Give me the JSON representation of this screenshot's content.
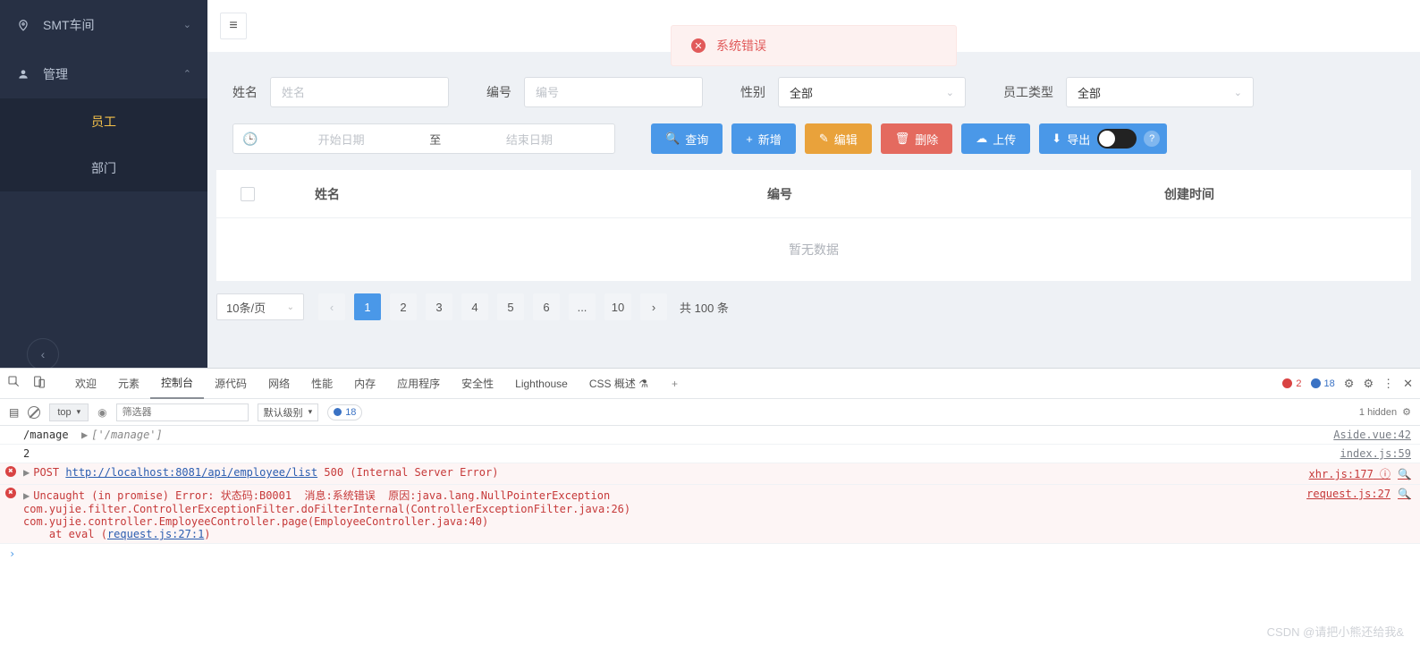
{
  "sidebar": {
    "group1": {
      "label": "SMT车间",
      "expanded": false
    },
    "group2": {
      "label": "管理",
      "expanded": true
    },
    "items": [
      {
        "label": "员工",
        "active": true
      },
      {
        "label": "部门",
        "active": false
      }
    ]
  },
  "error_banner": {
    "text": "系统错误"
  },
  "filters": {
    "name": {
      "label": "姓名",
      "placeholder": "姓名"
    },
    "code": {
      "label": "编号",
      "placeholder": "编号"
    },
    "gender": {
      "label": "性别",
      "value": "全部"
    },
    "emp_type": {
      "label": "员工类型",
      "value": "全部"
    },
    "date_range": {
      "start_ph": "开始日期",
      "sep": "至",
      "end_ph": "结束日期"
    }
  },
  "buttons": {
    "query": "查询",
    "add": "新增",
    "edit": "编辑",
    "delete": "删除",
    "upload": "上传",
    "export": "导出"
  },
  "table": {
    "columns": [
      "姓名",
      "编号",
      "创建时间"
    ],
    "empty": "暂无数据"
  },
  "pagination": {
    "page_size": "10条/页",
    "pages": [
      "1",
      "2",
      "3",
      "4",
      "5",
      "6",
      "...",
      "10"
    ],
    "total_label": "共 100 条"
  },
  "devtools": {
    "tabs": [
      "欢迎",
      "元素",
      "控制台",
      "源代码",
      "网络",
      "性能",
      "内存",
      "应用程序",
      "安全性",
      "Lighthouse",
      "CSS 概述 ⚗"
    ],
    "active_tab": "控制台",
    "err_count": "2",
    "info_count": "18",
    "sub": {
      "scope": "top",
      "filter_ph": "筛选器",
      "level": "默认级别",
      "badge_count": "18",
      "hidden": "1 hidden"
    },
    "logs": {
      "row1_left": "/manage",
      "row1_mid": "['/manage']",
      "row1_src": "Aside.vue:42",
      "row2_left": "2",
      "row2_src": "index.js:59",
      "row3_method": "POST",
      "row3_url": "http://localhost:8081/api/employee/list",
      "row3_status": "500 (Internal Server Error)",
      "row3_src": "xhr.js:177",
      "row4_line1": "Uncaught (in promise) Error: 状态码:B0001  消息:系统错误  原因:java.lang.NullPointerException",
      "row4_line2": "com.yujie.filter.ControllerExceptionFilter.doFilterInternal(ControllerExceptionFilter.java:26)",
      "row4_line3": "com.yujie.controller.EmployeeController.page(EmployeeController.java:40)",
      "row4_line4": "    at eval (",
      "row4_link": "request.js:27:1",
      "row4_line4_end": ")",
      "row4_src": "request.js:27"
    }
  },
  "watermark": "CSDN @请把小熊还给我&"
}
